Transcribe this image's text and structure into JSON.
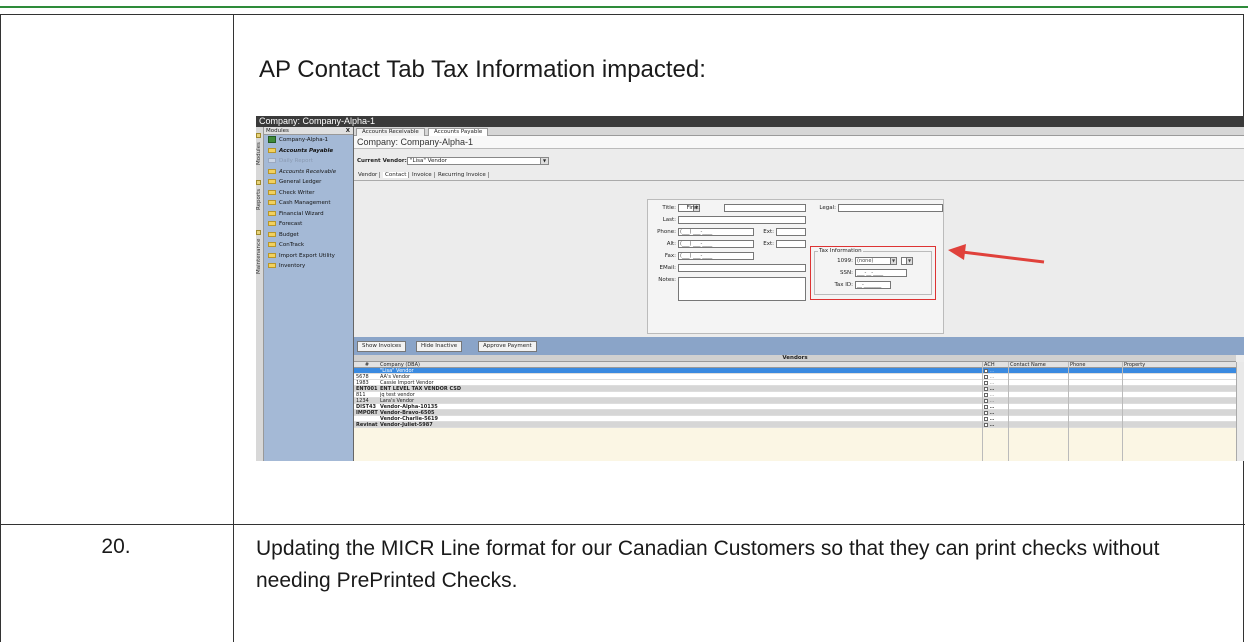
{
  "heading": "AP Contact Tab Tax Information impacted:",
  "row": {
    "number": "20.",
    "text": "Updating the MICR Line format for our Canadian Customers so that they can print checks without needing PrePrinted Checks."
  },
  "app": {
    "title": "Company: Company-Alpha-1",
    "side_tabs": [
      "Modules",
      "Reports",
      "Maintenance"
    ],
    "modules": {
      "header": "Modules",
      "close": "X",
      "items": [
        "Company-Alpha-1",
        "Accounts Payable",
        "Daily Report",
        "Accounts Receivable",
        "General Ledger",
        "Check Writer",
        "Cash Management",
        "Financial Wizard",
        "Forecast",
        "Budget",
        "ConTrack",
        "Import Export Utility",
        "Inventory"
      ]
    },
    "doc_tabs": [
      "Accounts Receivable",
      "Accounts Payable"
    ],
    "company_title": "Company: Company-Alpha-1",
    "current_vendor_label": "Current Vendor:",
    "current_vendor_value": "\"Lisa\" Vendor",
    "sub_tabs": [
      "Vendor",
      "Contact",
      "Invoice",
      "Recurring Invoice"
    ],
    "form": {
      "title_label": "Title:",
      "first_label": "First:",
      "legal_label": "Legal:",
      "last_label": "Last:",
      "phone_label": "Phone:",
      "phone_mask": "(___) ___-____",
      "ext_label": "Ext:",
      "alt_label": "Alt:",
      "fax_label": "Fax:",
      "email_label": "EMail:",
      "notes_label": "Notes:",
      "tax_legend": "Tax Information",
      "f1099_label": "1099:",
      "f1099_value": "(none)",
      "ssn_label": "SSN:",
      "ssn_mask": "___-__-____",
      "taxid_label": "Tax ID:",
      "taxid_mask": "__-_______"
    },
    "buttons": [
      "Show Invoices",
      "Hide Inactive",
      "Approve Payment"
    ],
    "grid": {
      "title": "Vendors",
      "headers": {
        "num": "#",
        "company": "Company (DBA)",
        "ach": "ACH",
        "contact": "Contact Name",
        "phone": "Phone",
        "property": "Property"
      },
      "rows": [
        {
          "num": "",
          "company": "\"Lisa\" Vendor"
        },
        {
          "num": "5678",
          "company": "AA's Vendor"
        },
        {
          "num": "1983",
          "company": "Cassie Import Vendor"
        },
        {
          "num": "ENT001",
          "company": "ENT LEVEL TAX VENDOR CSD"
        },
        {
          "num": "811",
          "company": "jq test vendor"
        },
        {
          "num": "1234",
          "company": "Lara's Vendor"
        },
        {
          "num": "DIST43",
          "company": "Vendor-Alpha-10135"
        },
        {
          "num": "IMPORT",
          "company": "Vendor-Bravo-6505"
        },
        {
          "num": "",
          "company": "Vendor-Charlie-5619"
        },
        {
          "num": "Revinat",
          "company": "Vendor-Juliet-5987"
        }
      ]
    }
  }
}
